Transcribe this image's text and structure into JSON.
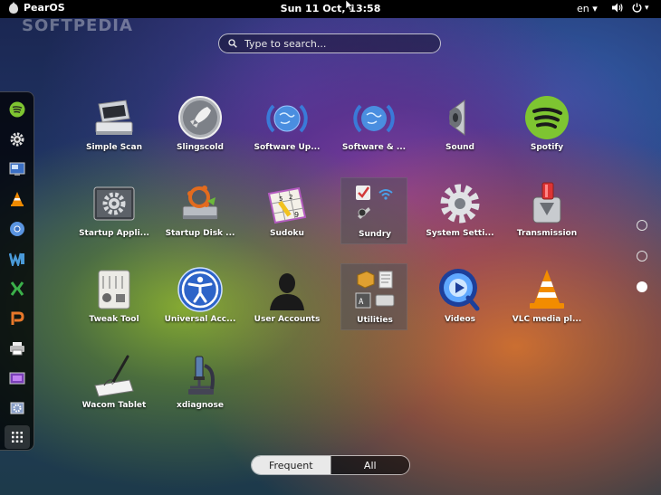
{
  "topbar": {
    "brand": "PearOS",
    "clock": "Sun 11 Oct, 13:58",
    "language": "en ▾",
    "tray_menu_arrow": "▾"
  },
  "watermark": "SOFTPEDIA",
  "search": {
    "placeholder": "Type to search..."
  },
  "dash": {
    "items": [
      {
        "icon": "spotify-icon"
      },
      {
        "icon": "settings-gear-icon"
      },
      {
        "icon": "system-monitor-icon"
      },
      {
        "icon": "vlc-icon"
      },
      {
        "icon": "chromium-icon"
      },
      {
        "icon": "libreoffice-writer-icon"
      },
      {
        "icon": "libreoffice-calc-icon"
      },
      {
        "icon": "libreoffice-impress-icon"
      },
      {
        "icon": "printer-icon"
      },
      {
        "icon": "screenshot-icon"
      },
      {
        "icon": "software-tools-icon"
      }
    ],
    "grid_icon": "show-applications-icon"
  },
  "apps": [
    {
      "label": "Simple Scan",
      "icon": "scanner-icon"
    },
    {
      "label": "Slingscold",
      "icon": "rocket-icon"
    },
    {
      "label": "Software Up...",
      "icon": "software-update-globe-icon"
    },
    {
      "label": "Software & ...",
      "icon": "software-sources-globe-icon"
    },
    {
      "label": "Sound",
      "icon": "speaker-icon"
    },
    {
      "label": "Spotify",
      "icon": "spotify-icon"
    },
    {
      "label": "Startup Appli...",
      "icon": "startup-apps-gear-icon"
    },
    {
      "label": "Startup Disk ...",
      "icon": "startup-disk-icon"
    },
    {
      "label": "Sudoku",
      "icon": "sudoku-icon"
    },
    {
      "label": "Sundry",
      "icon": "folder-sundry-icon"
    },
    {
      "label": "System Setti...",
      "icon": "system-settings-gear-icon"
    },
    {
      "label": "Transmission",
      "icon": "transmission-icon"
    },
    {
      "label": "Tweak Tool",
      "icon": "tweak-tool-icon"
    },
    {
      "label": "Universal Acc...",
      "icon": "accessibility-icon"
    },
    {
      "label": "User Accounts",
      "icon": "user-silhouette-icon"
    },
    {
      "label": "Utilities",
      "icon": "folder-utilities-icon"
    },
    {
      "label": "Videos",
      "icon": "videos-icon"
    },
    {
      "label": "VLC media pl...",
      "icon": "vlc-cone-icon"
    },
    {
      "label": "Wacom Tablet",
      "icon": "wacom-tablet-icon"
    },
    {
      "label": "xdiagnose",
      "icon": "microscope-icon"
    }
  ],
  "pager": {
    "pages": 3,
    "current_page": 3
  },
  "view_modes": {
    "frequent": "Frequent",
    "all": "All",
    "selected": "Frequent"
  }
}
